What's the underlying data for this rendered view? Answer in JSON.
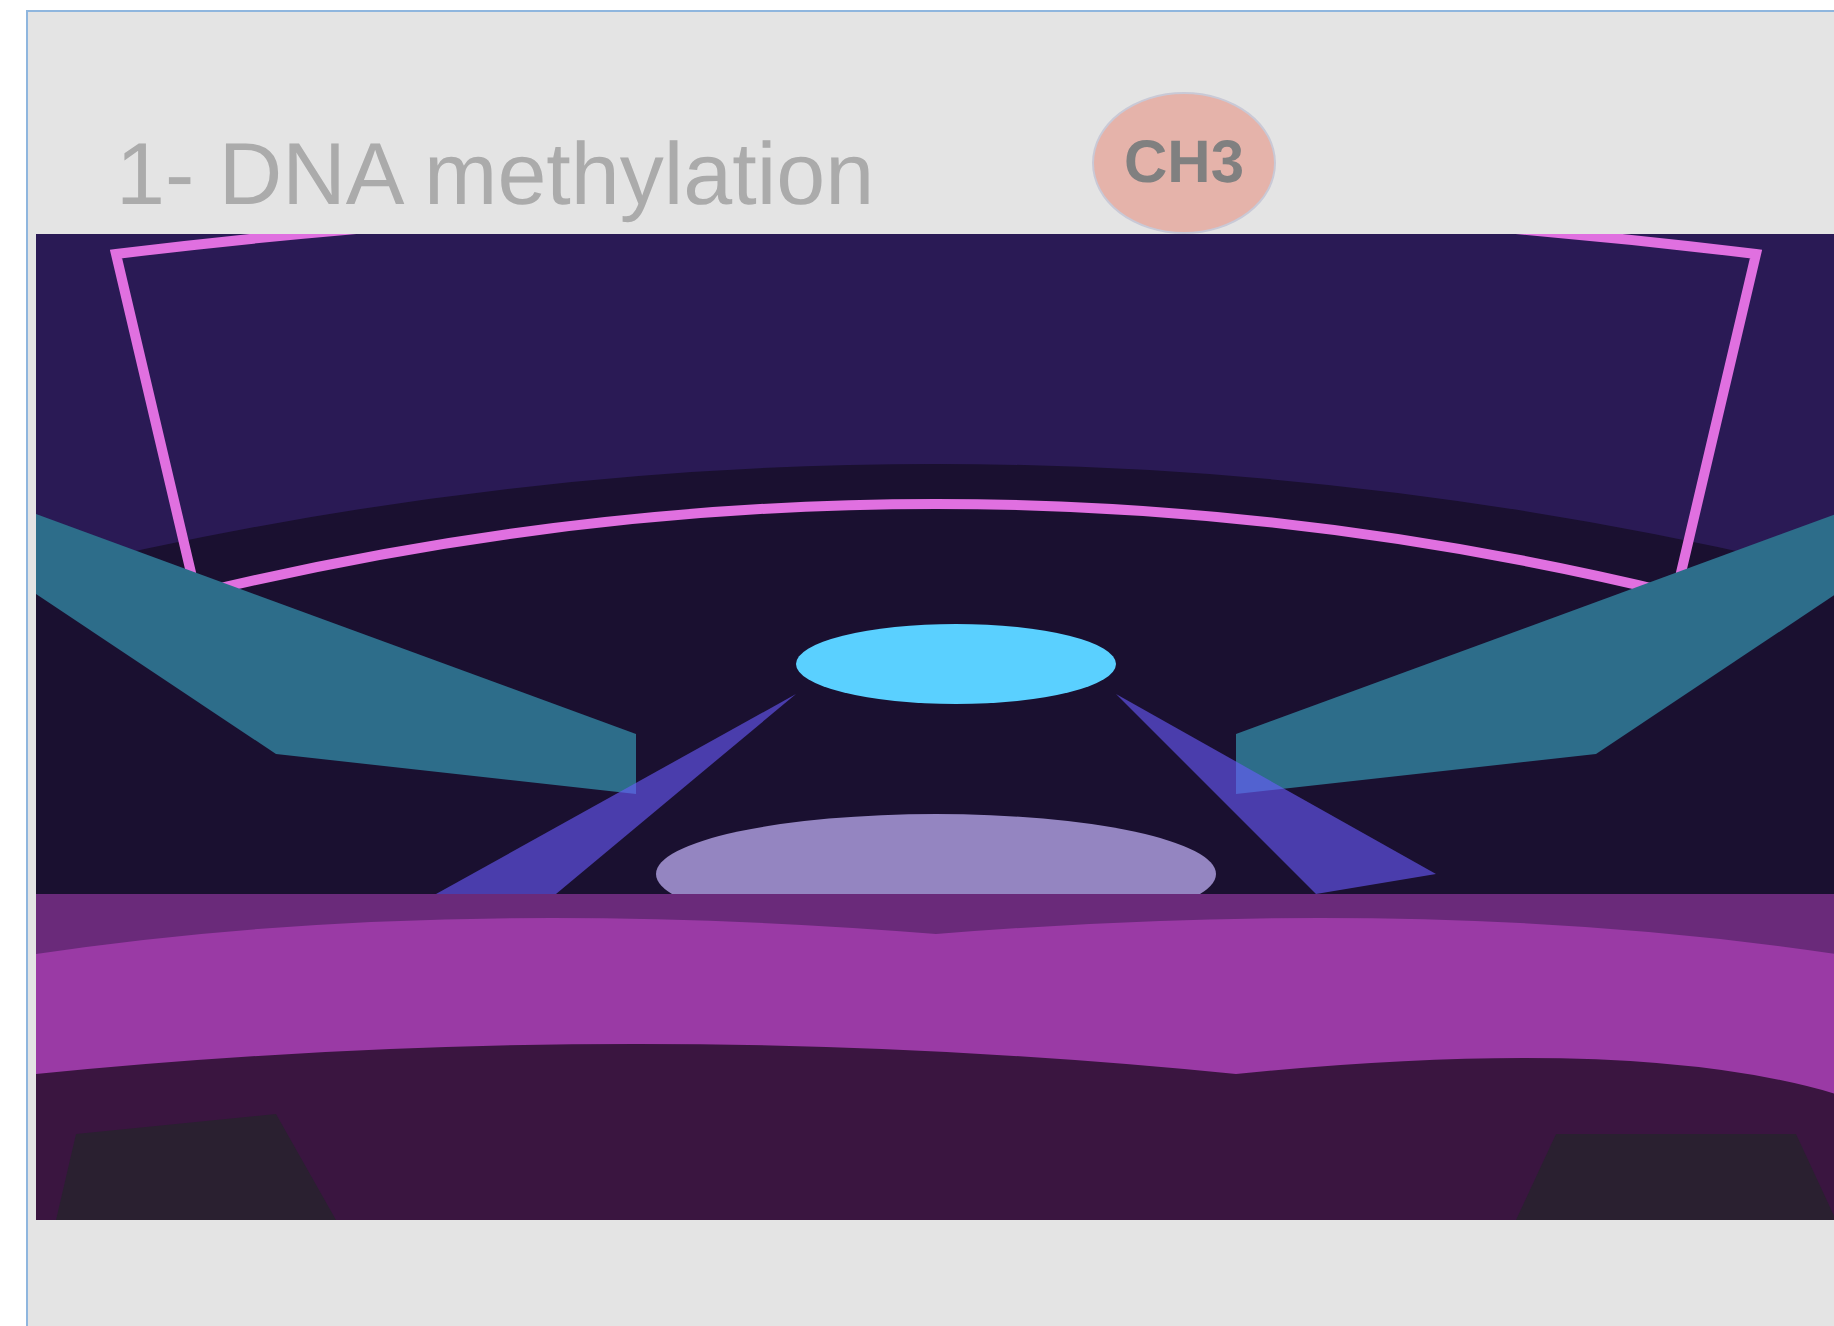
{
  "slide": {
    "items": [
      {
        "kind": "heading",
        "text": "1- DNA methylation"
      },
      {
        "kind": "bubble",
        "text": "CH3"
      },
      {
        "kind": "picture"
      }
    ]
  }
}
